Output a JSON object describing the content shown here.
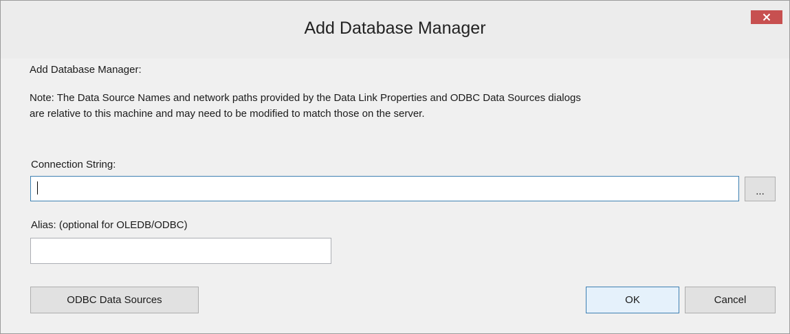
{
  "window": {
    "title": "Add Database Manager"
  },
  "dialog": {
    "heading": "Add Database Manager:",
    "note_line1": "Note: The Data Source Names and network paths provided by the Data Link Properties and ODBC Data Sources dialogs",
    "note_line2": "are relative to this machine and may need to be modified to match those on the server.",
    "connection_string_label": "Connection String:",
    "connection_string_value": "",
    "browse_label": "...",
    "alias_label": "Alias: (optional for OLEDB/ODBC)",
    "alias_value": ""
  },
  "buttons": {
    "odbc_label": "ODBC Data Sources",
    "ok_label": "OK",
    "cancel_label": "Cancel"
  },
  "icons": {
    "close": "close-icon"
  },
  "colors": {
    "close_button": "#c75050",
    "focus_border": "#3c7fb1",
    "dialog_bg": "#f0f0f0"
  }
}
